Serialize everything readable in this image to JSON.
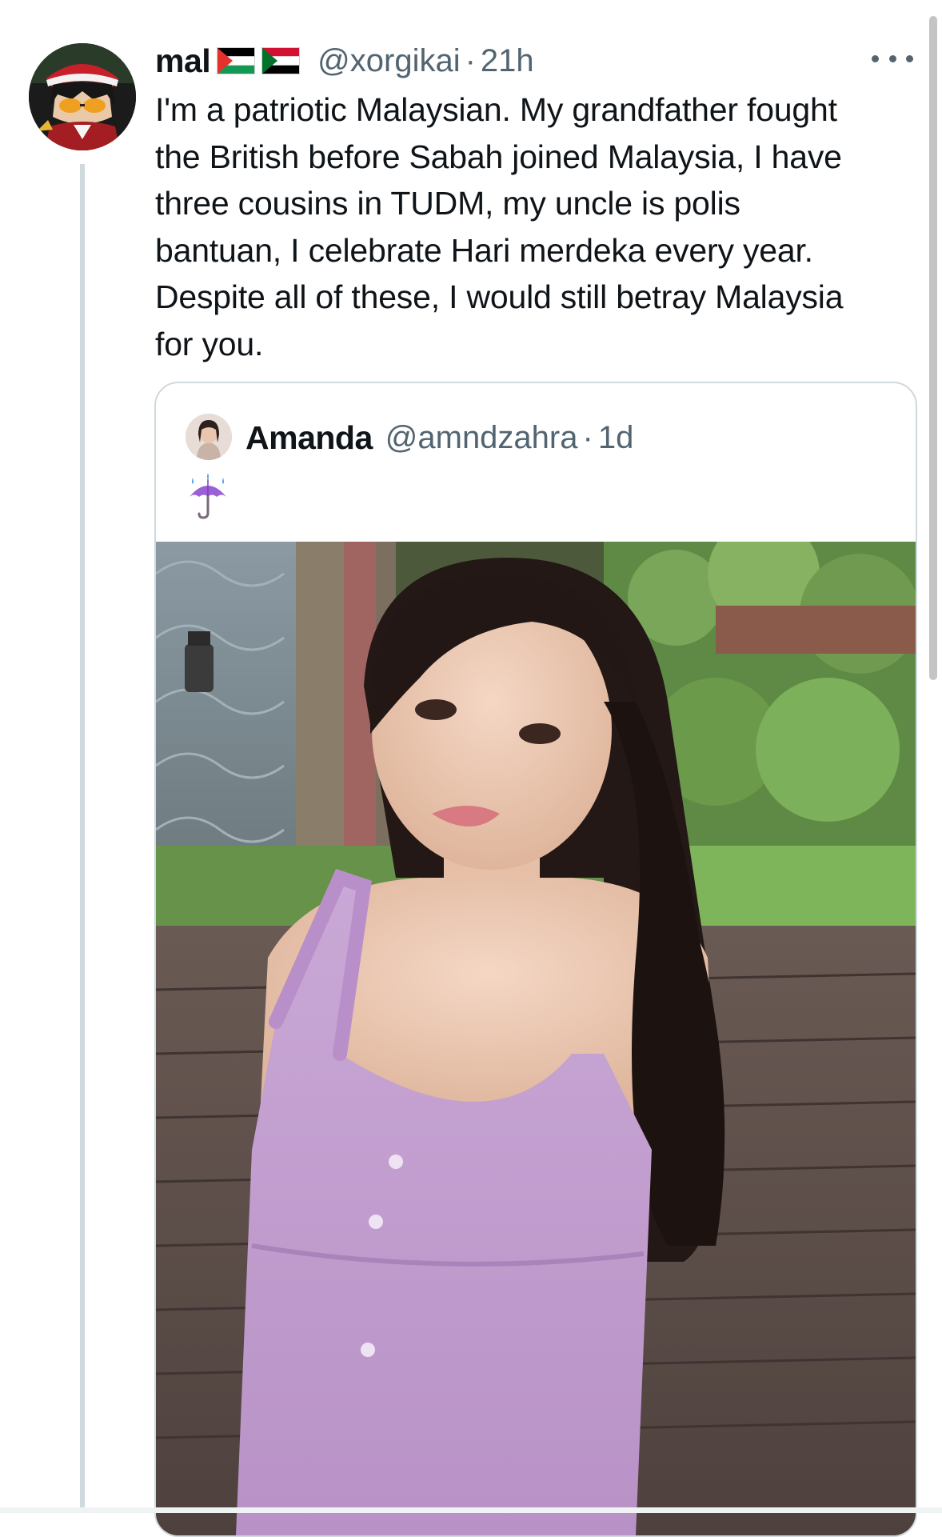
{
  "tweet": {
    "author": {
      "display_name": "mal",
      "flags": [
        "palestine-flag",
        "sudan-flag"
      ],
      "handle": "@xorgikai",
      "separator": "·",
      "time": "21h"
    },
    "text": "I'm a patriotic Malaysian. My grandfather fought the British before Sabah joined Malaysia, I have three cousins in TUDM, my uncle is polis bantuan, I celebrate Hari merdeka every year. Despite all of these, I would still betray Malaysia for you."
  },
  "quoted_tweet": {
    "author": {
      "display_name": "Amanda",
      "handle": "@amndzahra",
      "separator": "·",
      "time": "1d"
    },
    "emoji_icon": "umbrella-with-rain-icon",
    "media": "photo"
  },
  "icons": {
    "more": "more-dots-icon"
  },
  "colors": {
    "secondary_text": "#536471",
    "border": "#cfd9de"
  }
}
